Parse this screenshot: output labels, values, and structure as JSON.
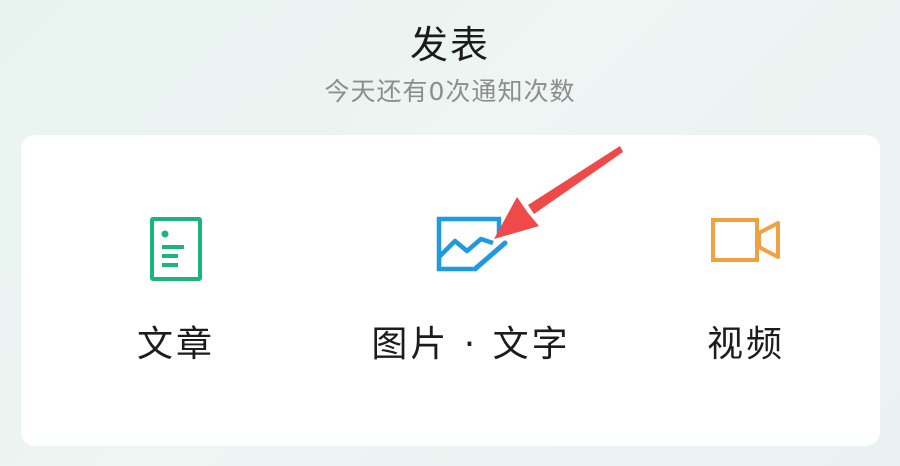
{
  "header": {
    "title": "发表",
    "subtitle": "今天还有0次通知次数"
  },
  "options": [
    {
      "label": "文章",
      "icon": "article-icon",
      "color": "#19b57c"
    },
    {
      "label": "图片 · 文字",
      "icon": "image-text-icon",
      "color": "#1e9ae0"
    },
    {
      "label": "视频",
      "icon": "video-icon",
      "color": "#f0a242"
    }
  ],
  "annotation": {
    "arrow_color": "#ef4a4a"
  }
}
